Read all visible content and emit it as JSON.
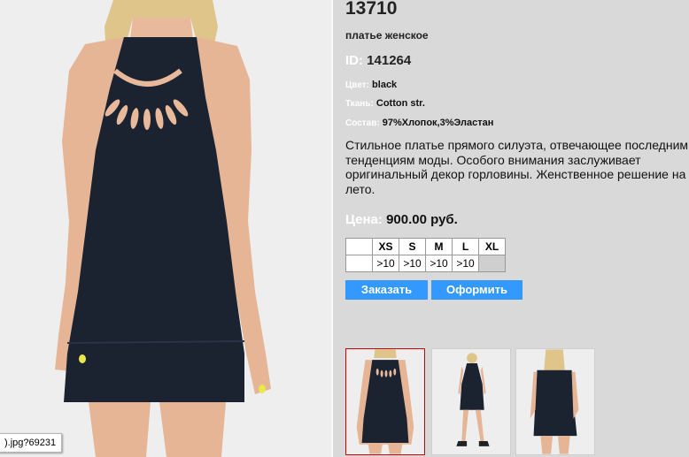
{
  "product": {
    "article": "13710",
    "subtitle": "платье женское",
    "id_label": "ID:",
    "id_value": "141264",
    "attributes": [
      {
        "label": "Цвет:",
        "value": "black"
      },
      {
        "label": "Ткань:",
        "value": "Cotton str."
      },
      {
        "label": "Состав:",
        "value": "97%Хлопок,3%Эластан"
      }
    ],
    "description": "Стильное платье прямого силуэта, отвечающее последним тенденциям моды. Особого внимания заслуживает оригинальный декор горловины.  Женственное решение на лето.",
    "price_label": "Цена:",
    "price_value": "900.00 руб."
  },
  "sizes": {
    "labels": [
      "XS",
      "S",
      "M",
      "L",
      "XL"
    ],
    "stock": [
      ">10",
      ">10",
      ">10",
      ">10",
      ""
    ]
  },
  "buttons": {
    "order": "Заказать",
    "checkout": "Оформить"
  },
  "status_tip": ").jpg?69231",
  "colors": {
    "page_bg": "#d9d9d9",
    "label_white": "#ffffff",
    "button_blue": "#3399ff",
    "thumb_selected_border": "#cc0000",
    "dress_navy": "#1b2230"
  },
  "icons": {
    "main_photo": "dress-photo",
    "thumbnails": [
      "dress-front-thumbnail",
      "dress-full-length-thumbnail",
      "dress-back-thumbnail"
    ]
  }
}
